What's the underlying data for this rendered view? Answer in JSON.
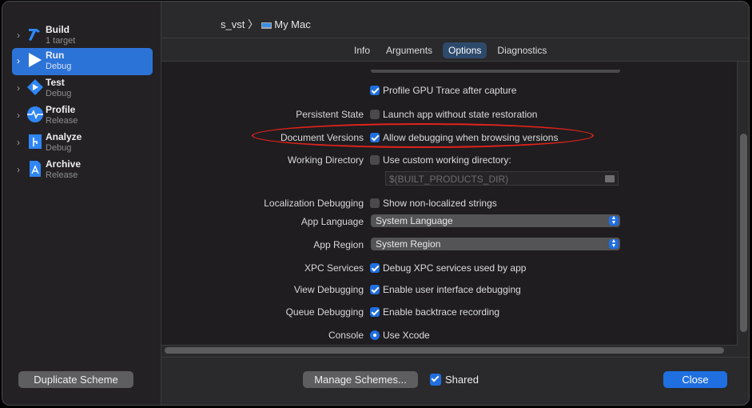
{
  "sidebar": {
    "items": [
      {
        "name": "Build",
        "sub": "1 target"
      },
      {
        "name": "Run",
        "sub": "Debug"
      },
      {
        "name": "Test",
        "sub": "Debug"
      },
      {
        "name": "Profile",
        "sub": "Release"
      },
      {
        "name": "Analyze",
        "sub": "Debug"
      },
      {
        "name": "Archive",
        "sub": "Release"
      }
    ]
  },
  "header": {
    "scheme": "s_vst",
    "separator": "〉",
    "destination": "My Mac"
  },
  "tabs": [
    "Info",
    "Arguments",
    "Options",
    "Diagnostics"
  ],
  "options": {
    "gpu_trace": "Profile GPU Trace after capture",
    "persistent_label": "Persistent State",
    "persistent_text": "Launch app without state restoration",
    "docver_label": "Document Versions",
    "docver_text": "Allow debugging when browsing versions",
    "workdir_label": "Working Directory",
    "workdir_text": "Use custom working directory:",
    "workdir_placeholder": "$(BUILT_PRODUCTS_DIR)",
    "loc_label": "Localization Debugging",
    "loc_text": "Show non-localized strings",
    "lang_label": "App Language",
    "lang_value": "System Language",
    "region_label": "App Region",
    "region_value": "System Region",
    "xpc_label": "XPC Services",
    "xpc_text": "Debug XPC services used by app",
    "view_label": "View Debugging",
    "view_text": "Enable user interface debugging",
    "queue_label": "Queue Debugging",
    "queue_text": "Enable backtrace recording",
    "console_label": "Console",
    "console_text": "Use Xcode"
  },
  "footer": {
    "duplicate": "Duplicate Scheme",
    "manage": "Manage Schemes...",
    "shared": "Shared",
    "close": "Close"
  },
  "colors": {
    "accent": "#1f6fe0",
    "selection": "#2c73d8",
    "highlight": "#e0231c"
  }
}
